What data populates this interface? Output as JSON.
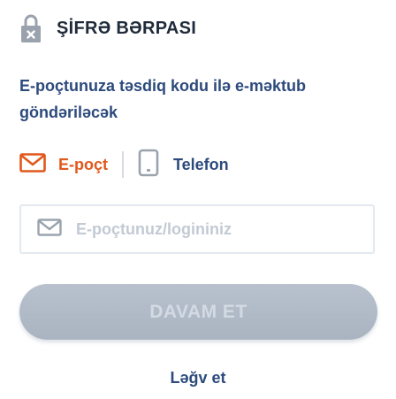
{
  "header": {
    "title": "ŞİFRƏ BƏRPASI",
    "icon": "lock-icon"
  },
  "subtitle": "E-poçtunuza təsdiq kodu ilə e-məktub göndəriləcək",
  "tabs": [
    {
      "label": "E-poçt",
      "icon": "envelope-icon",
      "active": true
    },
    {
      "label": "Telefon",
      "icon": "phone-icon",
      "active": false
    }
  ],
  "email_input": {
    "placeholder": "E-poçtunuz/logininiz",
    "value": "",
    "icon": "envelope-icon"
  },
  "continue_button": {
    "label": "DAVAM ET",
    "enabled": false
  },
  "cancel_link": "Ləğv et",
  "colors": {
    "accent": "#e0581c",
    "primary_text": "#2c4a7c",
    "title_text": "#1f2a3a",
    "button_disabled": "#aeb8c5",
    "icon_gray": "#9aa3ad"
  }
}
